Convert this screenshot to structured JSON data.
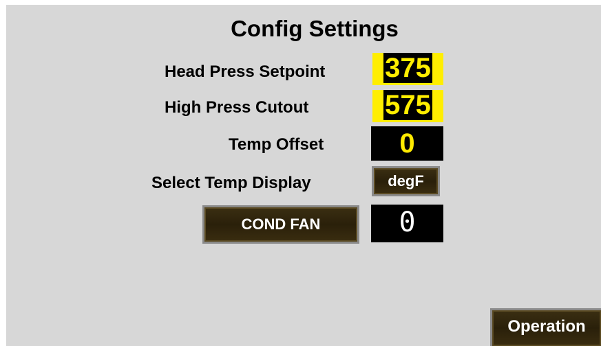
{
  "title": "Config Settings",
  "settings": {
    "head_press_label": "Head Press Setpoint",
    "head_press_value": "375",
    "high_press_label": "High Press Cutout",
    "high_press_value": "575",
    "temp_offset_label": "Temp Offset",
    "temp_offset_value": "0",
    "temp_display_label": "Select Temp Display",
    "temp_display_button": "degF"
  },
  "cond_fan": {
    "button_label": "COND FAN",
    "value": "0"
  },
  "nav": {
    "operation_button": "Operation"
  },
  "colors": {
    "panel": "#d7d7d7",
    "value_text": "#ffea00",
    "button_face": "#2f250c"
  }
}
